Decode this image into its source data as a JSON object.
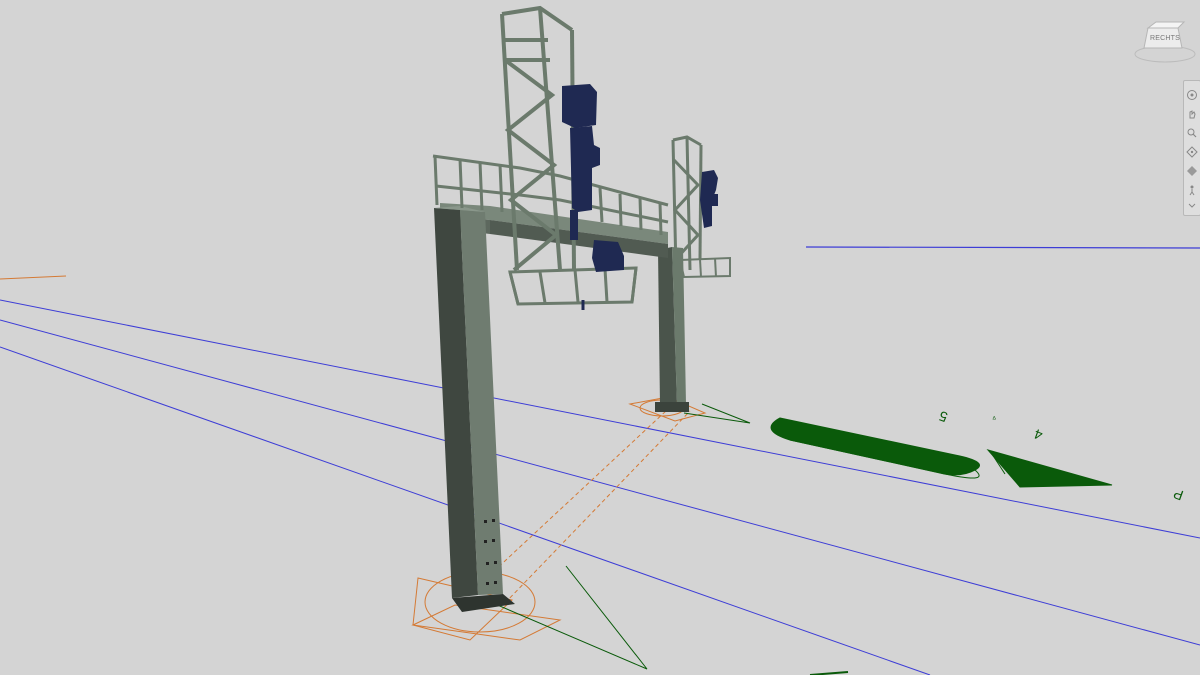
{
  "app": {
    "viewcube": {
      "label": "RECHTS",
      "name": "viewcube"
    },
    "navigation_bar": {
      "tools": [
        {
          "name": "full-navigation-wheel-icon"
        },
        {
          "name": "pan-icon"
        },
        {
          "name": "zoom-icon"
        },
        {
          "name": "orbit-icon"
        },
        {
          "name": "look-icon"
        },
        {
          "name": "walk-icon"
        },
        {
          "name": "customize-icon"
        }
      ]
    }
  },
  "scene": {
    "background_color": "#d4d4d4",
    "objects": [
      "signal-gantry",
      "rail-track-lines",
      "direction-arrows",
      "platform-marker"
    ],
    "track_labels": [
      {
        "name": "track-label-5",
        "text": "5"
      },
      {
        "name": "track-label-4",
        "text": "4"
      },
      {
        "name": "track-label-p",
        "text": "P"
      }
    ],
    "colors": {
      "gantry": "#6b7a6c",
      "signal_head": "#1f2952",
      "track_line": "#3d3dd6",
      "marker_green": "#0a5a0a",
      "foundation_orange": "#d47a35"
    }
  }
}
